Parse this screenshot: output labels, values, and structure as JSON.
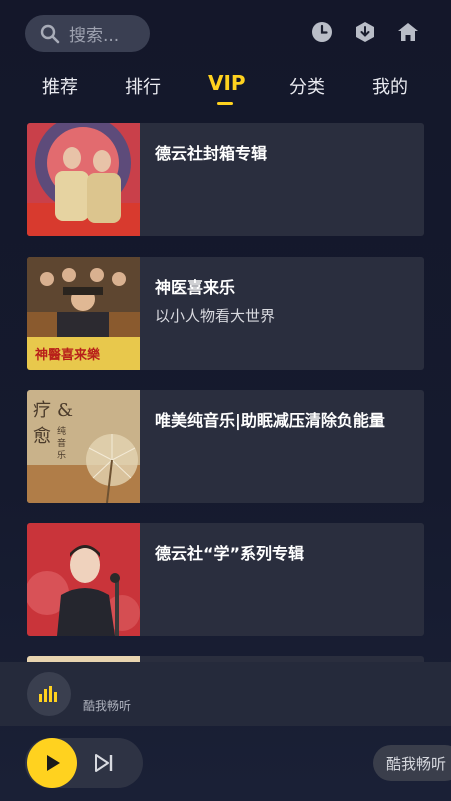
{
  "search": {
    "placeholder": "搜索..."
  },
  "header_icons": [
    "history-icon",
    "download-icon",
    "home-icon"
  ],
  "tabs": [
    {
      "label": "推荐"
    },
    {
      "label": "排行"
    },
    {
      "label": "VIP",
      "active": true
    },
    {
      "label": "分类"
    },
    {
      "label": "我的"
    }
  ],
  "albums": [
    {
      "title": "德云社封箱专辑",
      "subtitle": ""
    },
    {
      "title": "神医喜来乐",
      "subtitle": "以小人物看大世界"
    },
    {
      "title": "唯美纯音乐|助眠减压清除负能量",
      "subtitle": ""
    },
    {
      "title": "德云社“学”系列专辑",
      "subtitle": ""
    }
  ],
  "player": {
    "label": "酷我畅听"
  },
  "brand": {
    "label": "酷我畅听"
  },
  "colors": {
    "accent": "#ffd21f",
    "background": "#14172a",
    "card": "#2a2e3e"
  }
}
